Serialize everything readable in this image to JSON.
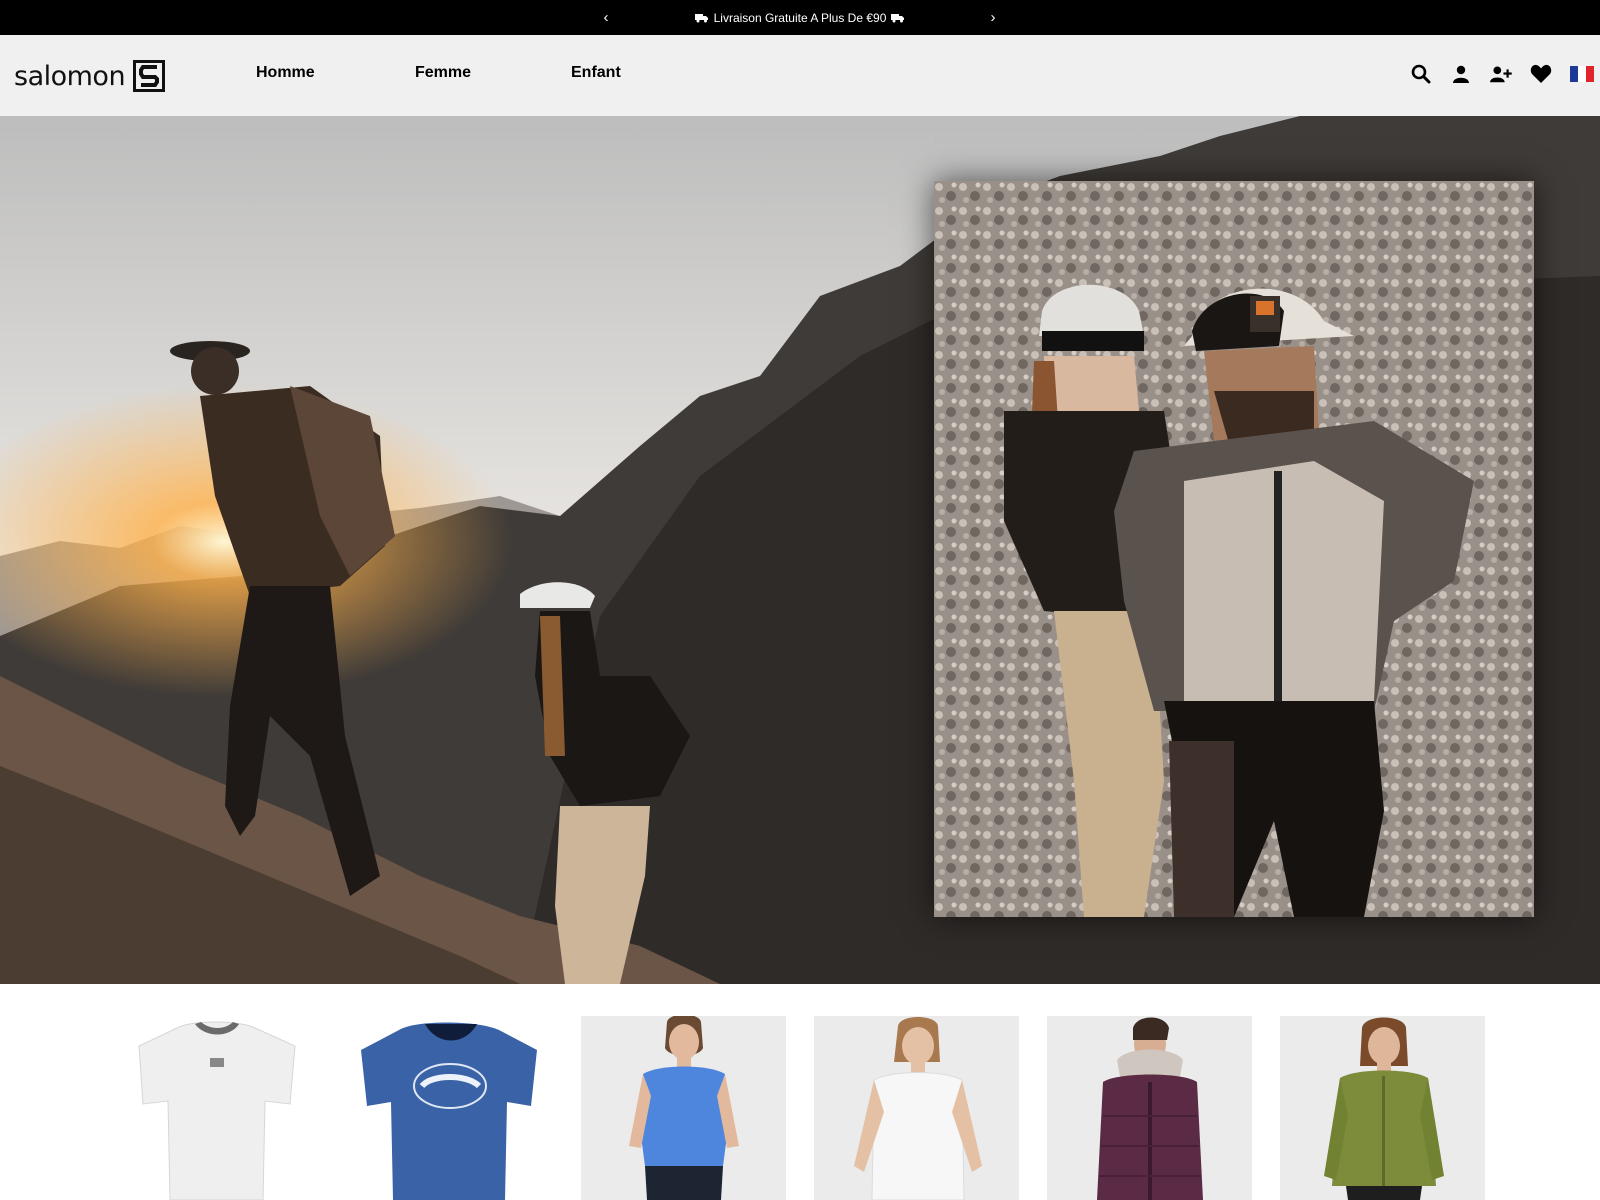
{
  "announcement": {
    "prev": "‹",
    "next": "›",
    "text": "Livraison Gratuite A Plus De €90",
    "icon": "truck-icon"
  },
  "header": {
    "logo_text": "salomon",
    "logo_icon": "salomon-s-logo",
    "nav": [
      "Homme",
      "Femme",
      "Enfant"
    ],
    "icons": [
      "search-icon",
      "account-icon",
      "add-user-icon",
      "wishlist-heart-icon",
      "france-flag-icon"
    ]
  },
  "hero": {
    "image": "hikers-mountain-photo",
    "inset_image": "hikers-closeup-photo"
  },
  "products": {
    "items": [
      {
        "name": "white-tshirt"
      },
      {
        "name": "blue-graphic-tshirt"
      },
      {
        "name": "woman-blue-top"
      },
      {
        "name": "woman-white-tshirt"
      },
      {
        "name": "woman-purple-parka"
      },
      {
        "name": "woman-green-jacket"
      }
    ]
  },
  "colors": {
    "announce_bg": "#000000",
    "header_bg": "#f0f0f0",
    "text": "#000000"
  }
}
